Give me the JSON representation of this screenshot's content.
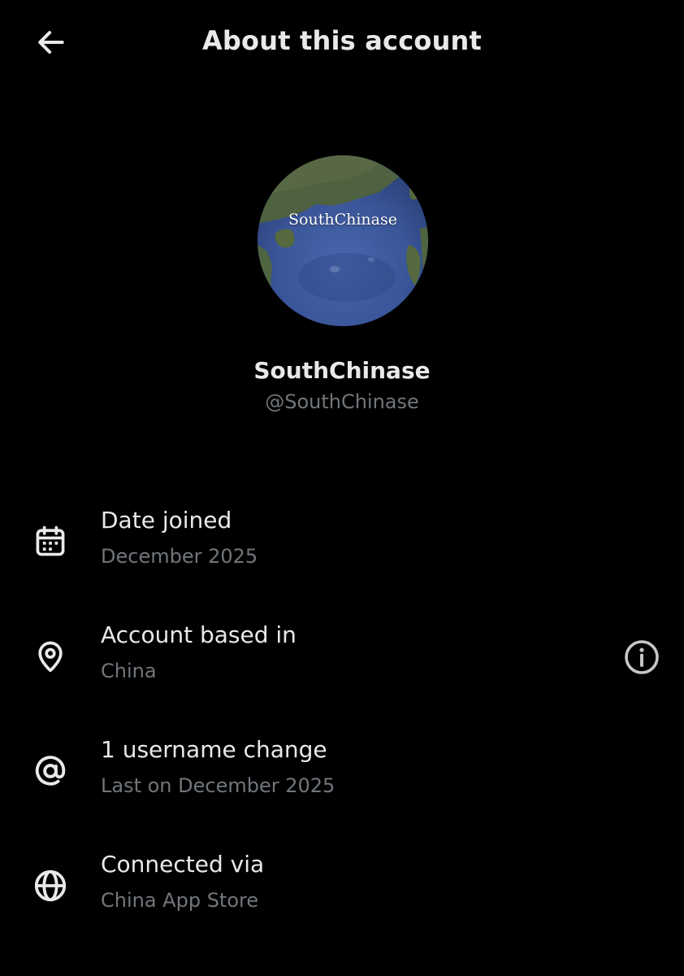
{
  "header": {
    "title": "About this account",
    "back_icon": "arrow-left-icon"
  },
  "profile": {
    "avatar_text": "SouthChinase",
    "display_name": "SouthChinase",
    "handle": "@SouthChinase"
  },
  "info": {
    "date_joined": {
      "icon": "calendar-icon",
      "label": "Date joined",
      "value": "December 2025"
    },
    "account_based_in": {
      "icon": "location-pin-icon",
      "label": "Account based in",
      "value": "China",
      "action_icon": "info-icon"
    },
    "username_changes": {
      "icon": "at-sign-icon",
      "label": "1 username change",
      "value": "Last on December 2025"
    },
    "connected_via": {
      "icon": "globe-icon",
      "label": "Connected via",
      "value": "China App Store"
    }
  },
  "colors": {
    "background": "#000000",
    "primary_text": "#e7e9ea",
    "secondary_text": "#71767b",
    "ocean": "#3d5a9e",
    "land": "#4a5f3a"
  }
}
